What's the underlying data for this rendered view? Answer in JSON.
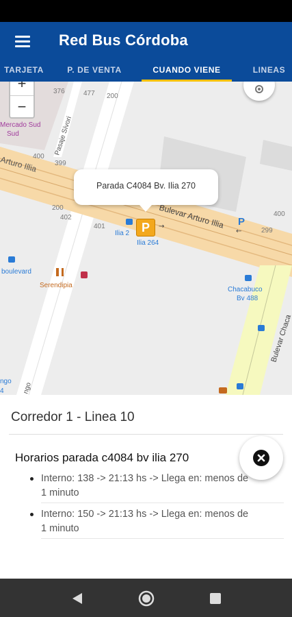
{
  "app": {
    "title": "Red Bus Córdoba"
  },
  "tabs": [
    {
      "label": "TARJETA"
    },
    {
      "label": "P. DE VENTA"
    },
    {
      "label": "CUANDO VIENE",
      "active": true
    },
    {
      "label": "LINEAS"
    }
  ],
  "map": {
    "popup_text": "Parada C4084 Bv. Ilia 270",
    "stop_marker_label": "P",
    "zoom_in": "+",
    "zoom_out": "−",
    "labels": {
      "mercado": "Mercado Sud",
      "mercado2": "Sud",
      "arturo_illia": "Arturo Illia",
      "bulevar_arturo_illia": "Bulevar Arturo Illia",
      "pasaje_sivori": "Pasaje Sívori",
      "ilia_264": "Ilia 264",
      "ilia_2": "Ilia 2",
      "boulevard": "boulevard",
      "serendipia": "Serendipia",
      "chacabuco": "Chacabuco",
      "chacabuco_bv": "Bv 488",
      "bulevar_chacabuco": "Bulevar Chaca",
      "n376": "376",
      "n477": "477",
      "n200a": "200",
      "n400a": "400",
      "n399": "399",
      "n200b": "200",
      "n402": "402",
      "n401": "401",
      "n400b": "400",
      "n299": "299",
      "ngo": "ngo",
      "ngo2": "4",
      "ngo3": "ngo"
    }
  },
  "sheet": {
    "title": "Corredor 1 - Linea 10",
    "schedule_title": "Horarios parada c4084 bv ilia 270",
    "items": [
      {
        "line1": "Interno: 138 -> 21:13 hs -> Llega en: menos de",
        "line2": "1 minuto"
      },
      {
        "line1": "Interno: 150 -> 21:13 hs -> Llega en: menos de",
        "line2": "1 minuto"
      }
    ]
  },
  "colors": {
    "app_bar": "#0b4b9a",
    "tab_indicator": "#f7c100",
    "stop_marker": "#f3a81d",
    "map_bg": "#ededed",
    "main_road": "#f7d9a8",
    "secondary_road": "#f6f9bf"
  },
  "icons": [
    "menu-icon",
    "locate-icon",
    "close-icon",
    "back-icon",
    "home-icon",
    "recents-icon",
    "bus-stop-icon",
    "restaurant-icon",
    "parking-icon"
  ]
}
